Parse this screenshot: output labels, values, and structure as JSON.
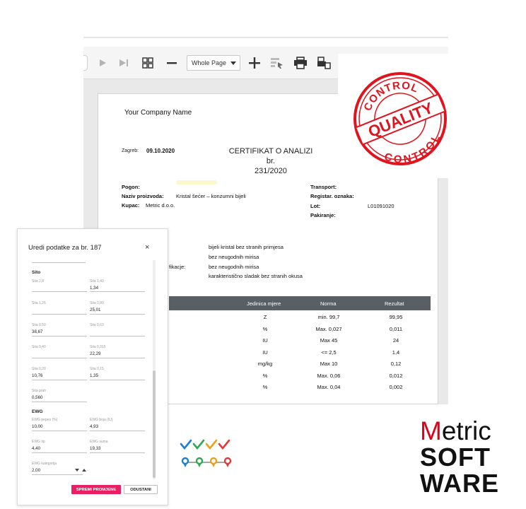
{
  "viewer": {
    "zoom_label": "Whole Page"
  },
  "document": {
    "company": "Your Company Name",
    "city_label": "Zagreb:",
    "date": "09.10.2020",
    "title": "CERTIFIKAT O ANALIZI",
    "number_label": "br.",
    "number": "231/2020",
    "left_fields": [
      {
        "label": "Pogon:",
        "value": ""
      },
      {
        "label": "Naziv proizvoda:",
        "value": "Kristal šećer – konzumni bijeli"
      },
      {
        "label": "Kupac:",
        "value": "Metric d.o.o."
      }
    ],
    "right_fields": [
      {
        "label": "Transport:",
        "value": ""
      },
      {
        "label": "Registar. oznaka:",
        "value": ""
      },
      {
        "label": "Lot:",
        "value": "L01091020"
      },
      {
        "label": "Pakiranje:",
        "value": ""
      }
    ],
    "spec_left_label": "fikacje:",
    "spec_lines": [
      "bijeli kristal bez stranih primjesa",
      "bez neugodnih mirisa",
      "bez neugodnih mirisa",
      "karakteristično sladak bez stranih okusa"
    ],
    "table": {
      "headers": [
        "Jedinica mjere",
        "Norma",
        "Rezultat"
      ],
      "rows": [
        [
          "Z",
          "min. 99,7",
          "99,95"
        ],
        [
          "%",
          "Max. 0,027",
          "0,011"
        ],
        [
          "IU",
          "Max 45",
          "24"
        ],
        [
          "IU",
          "<= 2,5",
          "1,4"
        ],
        [
          "mg/kg",
          "Max 10",
          "0,12"
        ],
        [
          "%",
          "Max. 0,06",
          "0,012"
        ],
        [
          "%",
          "Max. 0,04",
          "0,002"
        ]
      ]
    }
  },
  "stamp": {
    "top": "CONTROL",
    "middle": "QUALITY",
    "bottom": "CONTROL",
    "color": "#e0141e"
  },
  "editor": {
    "title": "Uredi podatke za br. 187",
    "close_glyph": "×",
    "sito_title": "Sito",
    "sito_fields": [
      {
        "label": "Sita 2,8",
        "value": ""
      },
      {
        "label": "Sita 1,40",
        "value": "1,34"
      },
      {
        "label": "Sita 1,25",
        "value": ""
      },
      {
        "label": "Sita 0,80",
        "value": "25,01"
      },
      {
        "label": "Sita 0,50",
        "value": "38,67"
      },
      {
        "label": "Sita 0,63",
        "value": ""
      },
      {
        "label": "Sita 0,40",
        "value": ""
      },
      {
        "label": "Sita 0,315",
        "value": "22,29"
      },
      {
        "label": "Sita 0,20",
        "value": "10,76"
      },
      {
        "label": "Sita 0,15",
        "value": "1,35"
      },
      {
        "label": "Sita prah",
        "value": "0,560"
      }
    ],
    "ewg_title": "EWG",
    "ewg_fields": [
      {
        "label": "EWG pepeo (%)",
        "value": "10,00"
      },
      {
        "label": "EWG boja (IU)",
        "value": "4,93"
      },
      {
        "label": "EWG tip",
        "value": "4,40"
      },
      {
        "label": "EWG suma",
        "value": "19,33"
      },
      {
        "label": "EWG kategorija",
        "value": "2,00"
      }
    ],
    "save_label": "SPREMI PROMJENE",
    "cancel_label": "ODUSTANI",
    "accent": "#ea1f63"
  },
  "logo": {
    "line1_first": "M",
    "line1_rest": "etric",
    "line2": "SOFT",
    "line3": "WARE",
    "red": "#e1001a"
  }
}
